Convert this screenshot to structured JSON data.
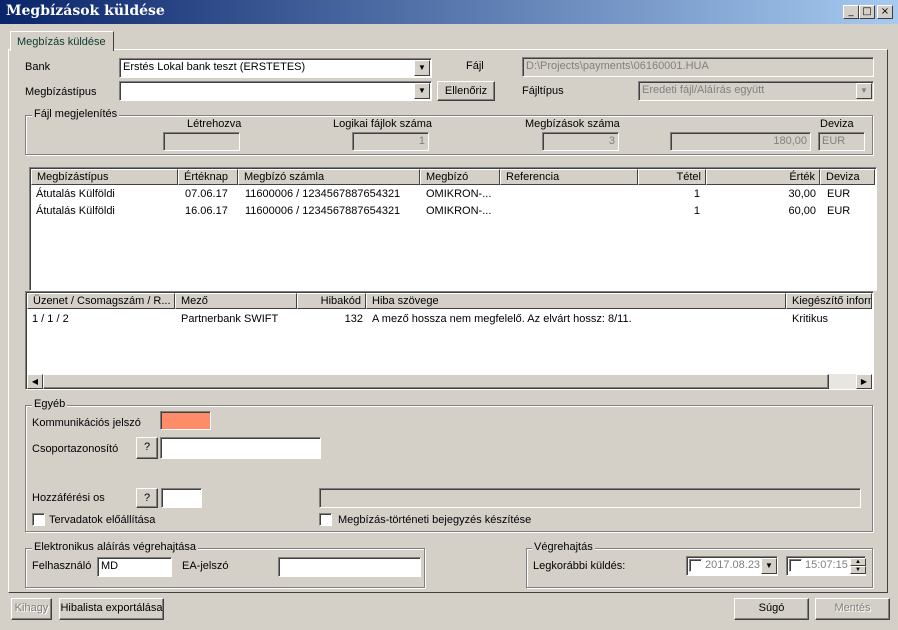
{
  "window": {
    "title": "Megbízások küldése",
    "minimize": "_",
    "maximize": "□",
    "close": "×"
  },
  "tab": {
    "label": "Megbízás küldése"
  },
  "bank": {
    "label": "Bank",
    "value": "Erstés Lokal bank teszt (ERSTETES)"
  },
  "type": {
    "label": "Megbízástípus",
    "value": "",
    "check_button": "Ellenőriz"
  },
  "file": {
    "label": "Fájl",
    "value": "D:\\Projects\\payments\\06160001.HUA"
  },
  "filetype": {
    "label": "Fájltípus",
    "value": "Eredeti fájl/Aláírás együtt"
  },
  "file_display": {
    "group_label": "Fájl megjelenítés",
    "created_label": "Létrehozva",
    "created_value": "",
    "logical_label": "Logikai fájlok száma",
    "logical_value": "1",
    "orders_label": "Megbízások száma",
    "orders_value": "3",
    "amount_value": "180,00",
    "currency_label": "Deviza",
    "currency_value": "EUR"
  },
  "orders_table": {
    "columns": [
      "Megbízástípus",
      "Értéknap",
      "Megbízó számla",
      "Megbízó",
      "Referencia",
      "Tétel",
      "Érték",
      "Deviza"
    ],
    "rows": [
      [
        "Átutalás Külföldi",
        "07.06.17",
        "11600006 / 1234567887654321",
        "OMIKRON-...",
        "",
        "1",
        "30,00",
        "EUR"
      ],
      [
        "Átutalás Külföldi",
        "16.06.17",
        "11600006 / 1234567887654321",
        "OMIKRON-...",
        "",
        "1",
        "60,00",
        "EUR"
      ]
    ]
  },
  "errors_table": {
    "columns": [
      "Üzenet / Csomagszám / R...",
      "Mező",
      "Hibakód",
      "Hiba szövege",
      "Kiegészítő inform"
    ],
    "rows": [
      [
        "1 / 1 / 2",
        "Partnerbank SWIFT",
        "132",
        "A mező hossza nem megfelelő. Az elvárt hossz:  8/11.",
        "Kritikus"
      ]
    ]
  },
  "other": {
    "group_label": "Egyéb",
    "comm_pw_label": "Kommunikációs jelszó",
    "group_id_label": "Csoportazonosító",
    "access_label": "Hozzáférési os",
    "help_q": "?",
    "plan_label": "Tervadatok előállítása",
    "history_label": "Megbízás-történeti bejegyzés készítése"
  },
  "signature": {
    "group_label": "Elektronikus aláírás végrehajtása",
    "user_label": "Felhasználó",
    "user_value": "MD",
    "ea_label": "EA-jelszó"
  },
  "exec": {
    "group_label": "Végrehajtás",
    "earliest_label": "Legkorábbi küldés:",
    "date": "2017.08.23",
    "time": "15:07:15"
  },
  "buttons": {
    "skip": "Kihagy",
    "export": "Hibalista exportálása",
    "help": "Súgó",
    "save": "Mentés"
  },
  "colors": {
    "title_start": "#0a246a",
    "title_end": "#a6caf0",
    "password_fill": "#ff8c69"
  }
}
